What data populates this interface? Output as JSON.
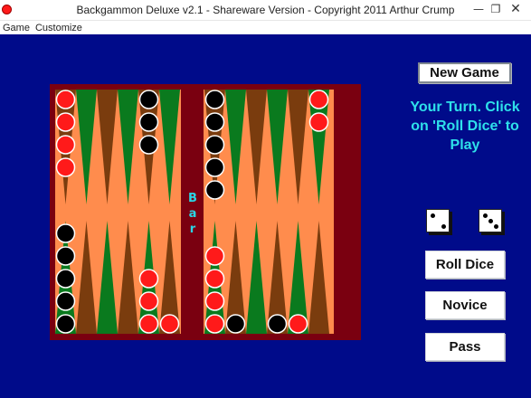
{
  "window": {
    "title": "Backgammon Deluxe v2.1 - Shareware Version - Copyright 2011 Arthur Crump",
    "minimize_glyph": "—",
    "maximize_glyph": "❐",
    "close_glyph": "✕"
  },
  "menu": {
    "items": [
      "Game",
      "Customize"
    ]
  },
  "board": {
    "bar_label": [
      "B",
      "a",
      "r"
    ],
    "colors": {
      "frame": "#7a0010",
      "field": "#ff8c4d",
      "point_dark": "#7a3c0e",
      "point_green": "#0a7a1e",
      "player_checker": "#ff1a1a",
      "opponent_checker": "#000000"
    }
  },
  "status": {
    "message": "Your Turn. Click on 'Roll Dice' to Play"
  },
  "dice": {
    "values": [
      2,
      3
    ]
  },
  "buttons": {
    "new_game": "New Game",
    "roll_dice": "Roll Dice",
    "difficulty": "Novice",
    "pass": "Pass"
  }
}
